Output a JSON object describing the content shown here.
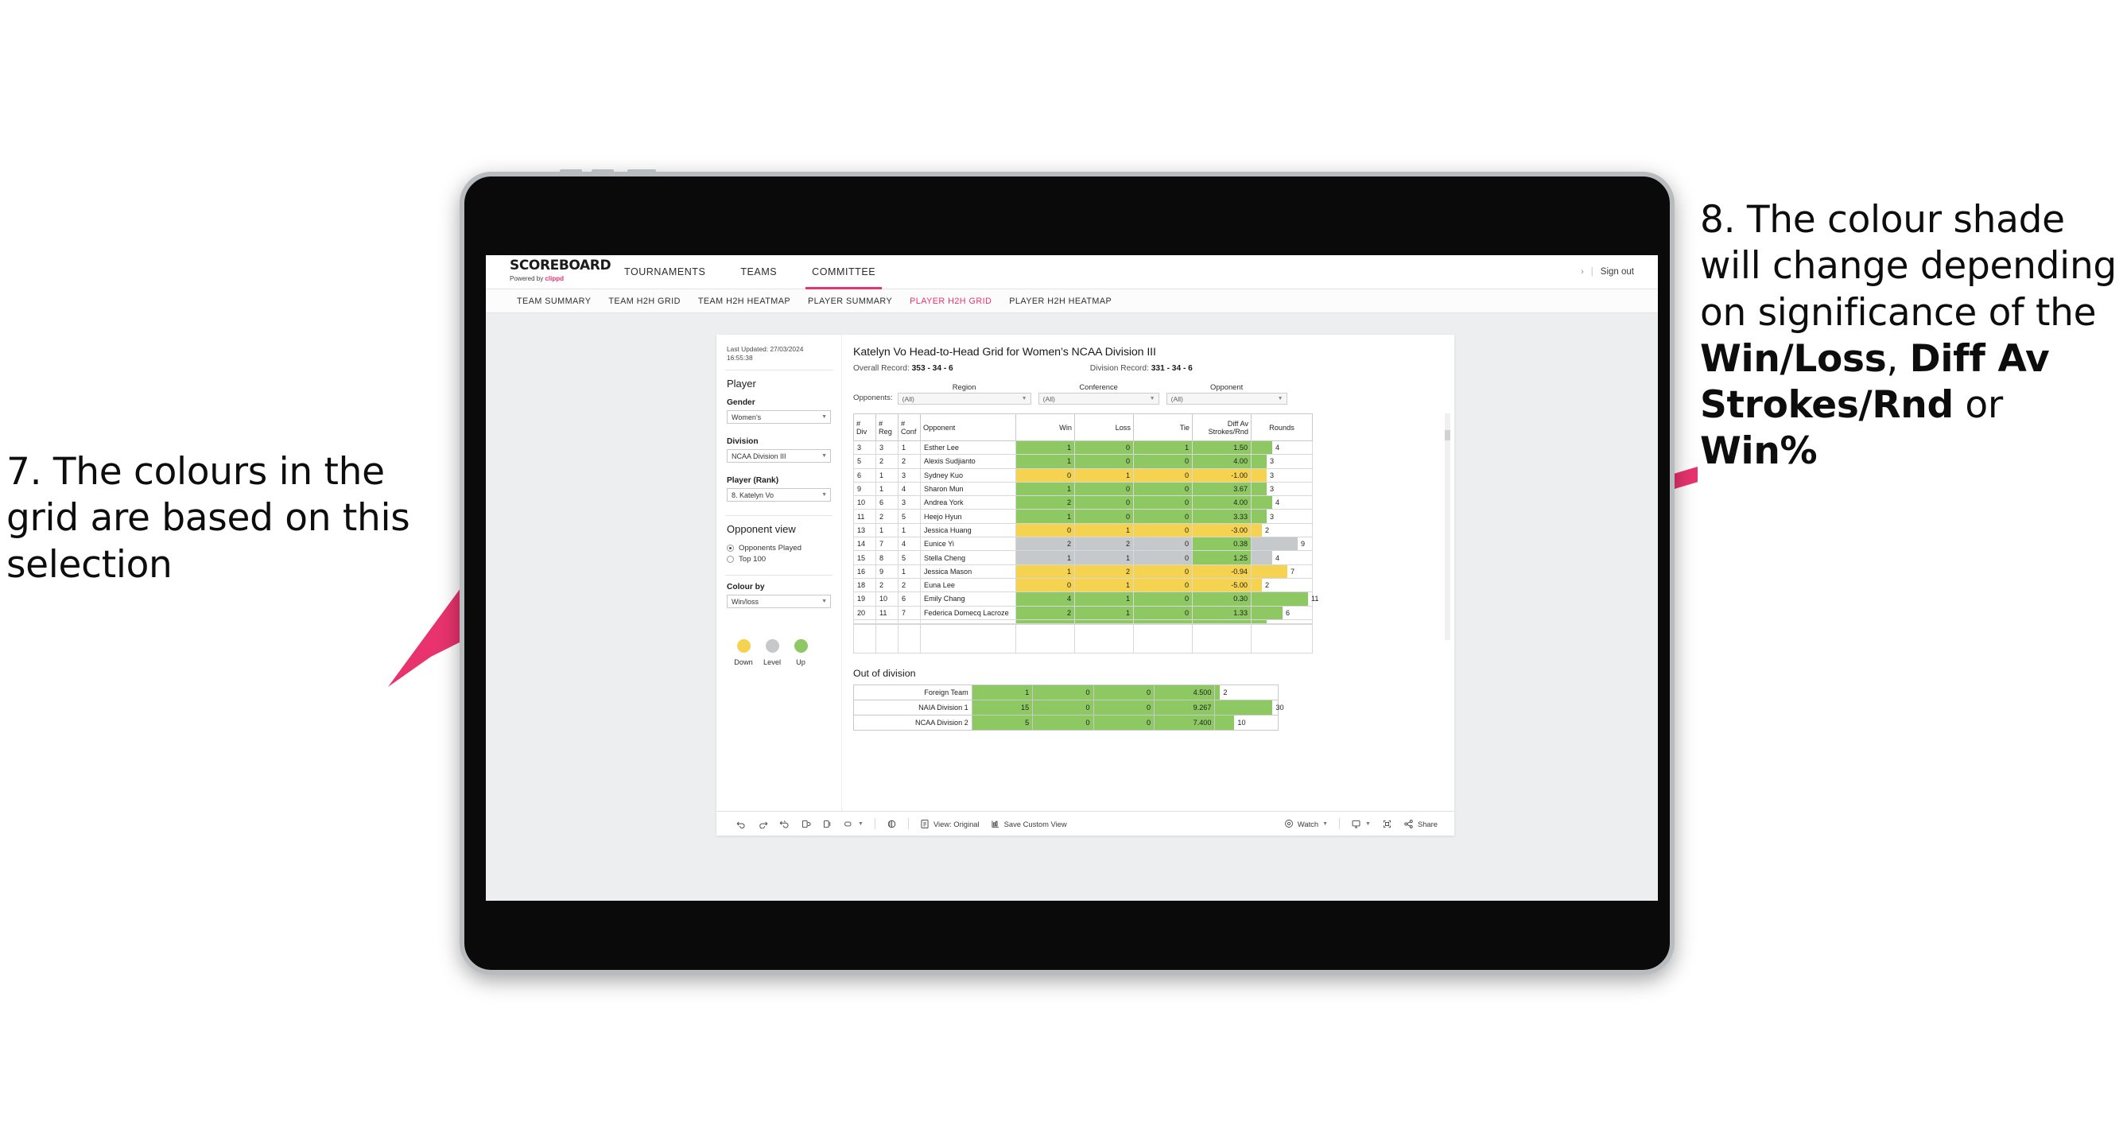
{
  "annotations": {
    "left": {
      "id": "callout-7",
      "text": "7. The colours in the grid are based on this selection"
    },
    "right": {
      "id": "callout-8",
      "pre": "8. The colour shade will change depending on significance of the ",
      "bold1": "Win/Loss",
      "mid1": ", ",
      "bold2": "Diff Av Strokes/Rnd",
      "mid2": " or ",
      "bold3": "Win%"
    },
    "arrow_color": "#E8336E"
  },
  "app": {
    "logo": {
      "wordmark": "SCOREBOARD",
      "powered_prefix": "Powered by ",
      "brand": "clippd"
    },
    "topnav": [
      {
        "label": "TOURNAMENTS",
        "active": false
      },
      {
        "label": "TEAMS",
        "active": false
      },
      {
        "label": "COMMITTEE",
        "active": true
      }
    ],
    "signout": {
      "chevron": "›",
      "divider": "|",
      "label": "Sign out"
    },
    "subnav": [
      {
        "label": "TEAM SUMMARY",
        "active": false
      },
      {
        "label": "TEAM H2H GRID",
        "active": false
      },
      {
        "label": "TEAM H2H HEATMAP",
        "active": false
      },
      {
        "label": "PLAYER SUMMARY",
        "active": false
      },
      {
        "label": "PLAYER H2H GRID",
        "active": true
      },
      {
        "label": "PLAYER H2H HEATMAP",
        "active": false
      }
    ],
    "accent": "#E8336E"
  },
  "sidebar": {
    "last_updated": "Last Updated: 27/03/2024 16:55:38",
    "section_player": "Player",
    "gender": {
      "label": "Gender",
      "value": "Women’s"
    },
    "division": {
      "label": "Division",
      "value": "NCAA Division III"
    },
    "player_rank": {
      "label": "Player (Rank)",
      "value": "8. Katelyn Vo"
    },
    "opponent_view": {
      "label": "Opponent view",
      "options": [
        {
          "label": "Opponents Played",
          "selected": true
        },
        {
          "label": "Top 100",
          "selected": false
        }
      ]
    },
    "colour_by": {
      "label": "Colour by",
      "value": "Win/loss"
    },
    "legend": [
      {
        "caption": "Down",
        "color": "#F5D351"
      },
      {
        "caption": "Level",
        "color": "#C6C9CC"
      },
      {
        "caption": "Up",
        "color": "#8DC863"
      }
    ]
  },
  "main": {
    "title": "Katelyn Vo Head-to-Head Grid for Women’s NCAA Division III",
    "overall_label": "Overall Record:",
    "overall_value": "353 -  34 - 6",
    "division_label": "Division Record:",
    "division_value": "331 -  34 - 6",
    "filters": {
      "row_label": "Opponents:",
      "items": [
        {
          "caption": "Region",
          "value": "(All)"
        },
        {
          "caption": "Conference",
          "value": "(All)"
        },
        {
          "caption": "Opponent",
          "value": "(All)"
        }
      ]
    },
    "grid_headers": [
      "# Div",
      "# Reg",
      "# Conf",
      "Opponent",
      "Win",
      "Loss",
      "Tie",
      "Diff Av Strokes/Rnd",
      "Rounds"
    ],
    "out_of_division_title": "Out of division"
  },
  "chart_data": {
    "type": "table",
    "title": "Katelyn Vo Head-to-Head Grid for Women’s NCAA Division III",
    "columns": [
      "# Div",
      "# Reg",
      "# Conf",
      "Opponent",
      "Win",
      "Loss",
      "Tie",
      "Diff Av Strokes/Rnd",
      "Rounds"
    ],
    "colour_scale": {
      "up": "#8DC863",
      "level": "#C6C9CC",
      "down": "#F5D351"
    },
    "rounds_bar_max": 12,
    "rows": [
      {
        "div": "3",
        "reg": "3",
        "conf": "1",
        "opponent": "Esther Lee",
        "win": "1",
        "loss": "0",
        "tie": "1",
        "diff": "1.50",
        "rounds": 4,
        "color": "#8DC863"
      },
      {
        "div": "5",
        "reg": "2",
        "conf": "2",
        "opponent": "Alexis Sudjianto",
        "win": "1",
        "loss": "0",
        "tie": "0",
        "diff": "4.00",
        "rounds": 3,
        "color": "#8DC863"
      },
      {
        "div": "6",
        "reg": "1",
        "conf": "3",
        "opponent": "Sydney Kuo",
        "win": "0",
        "loss": "1",
        "tie": "0",
        "diff": "-1.00",
        "rounds": 3,
        "color": "#F5D351"
      },
      {
        "div": "9",
        "reg": "1",
        "conf": "4",
        "opponent": "Sharon Mun",
        "win": "1",
        "loss": "0",
        "tie": "0",
        "diff": "3.67",
        "rounds": 3,
        "color": "#8DC863"
      },
      {
        "div": "10",
        "reg": "6",
        "conf": "3",
        "opponent": "Andrea York",
        "win": "2",
        "loss": "0",
        "tie": "0",
        "diff": "4.00",
        "rounds": 4,
        "color": "#8DC863"
      },
      {
        "div": "11",
        "reg": "2",
        "conf": "5",
        "opponent": "Heejo Hyun",
        "win": "1",
        "loss": "0",
        "tie": "0",
        "diff": "3.33",
        "rounds": 3,
        "color": "#8DC863"
      },
      {
        "div": "13",
        "reg": "1",
        "conf": "1",
        "opponent": "Jessica Huang",
        "win": "0",
        "loss": "1",
        "tie": "0",
        "diff": "-3.00",
        "rounds": 2,
        "color": "#F5D351"
      },
      {
        "div": "14",
        "reg": "7",
        "conf": "4",
        "opponent": "Eunice Yi",
        "win": "2",
        "loss": "2",
        "tie": "0",
        "diff": "0.38",
        "rounds": 9,
        "color": "#C6C9CC",
        "diff_color": "#8DC863"
      },
      {
        "div": "15",
        "reg": "8",
        "conf": "5",
        "opponent": "Stella Cheng",
        "win": "1",
        "loss": "1",
        "tie": "0",
        "diff": "1.25",
        "rounds": 4,
        "color": "#C6C9CC",
        "diff_color": "#8DC863"
      },
      {
        "div": "16",
        "reg": "9",
        "conf": "1",
        "opponent": "Jessica Mason",
        "win": "1",
        "loss": "2",
        "tie": "0",
        "diff": "-0.94",
        "rounds": 7,
        "color": "#F5D351"
      },
      {
        "div": "18",
        "reg": "2",
        "conf": "2",
        "opponent": "Euna Lee",
        "win": "0",
        "loss": "1",
        "tie": "0",
        "diff": "-5.00",
        "rounds": 2,
        "color": "#F5D351"
      },
      {
        "div": "19",
        "reg": "10",
        "conf": "6",
        "opponent": "Emily Chang",
        "win": "4",
        "loss": "1",
        "tie": "0",
        "diff": "0.30",
        "rounds": 11,
        "color": "#8DC863"
      },
      {
        "div": "20",
        "reg": "11",
        "conf": "7",
        "opponent": "Federica Domecq Lacroze",
        "win": "2",
        "loss": "1",
        "tie": "0",
        "diff": "1.33",
        "rounds": 6,
        "color": "#8DC863"
      }
    ],
    "out_of_division": [
      {
        "name": "Foreign Team",
        "win": "1",
        "loss": "0",
        "tie": "0",
        "diff": "4.500",
        "rounds": 2,
        "color": "#8DC863"
      },
      {
        "name": "NAIA Division 1",
        "win": "15",
        "loss": "0",
        "tie": "0",
        "diff": "9.267",
        "rounds": 30,
        "color": "#8DC863"
      },
      {
        "name": "NCAA Division 2",
        "win": "5",
        "loss": "0",
        "tie": "0",
        "diff": "7.400",
        "rounds": 10,
        "color": "#8DC863"
      }
    ],
    "out_of_division_bar_max": 32
  },
  "toolbar": {
    "view_label": "View: Original",
    "save_label": "Save Custom View",
    "watch_label": "Watch",
    "share_label": "Share"
  }
}
